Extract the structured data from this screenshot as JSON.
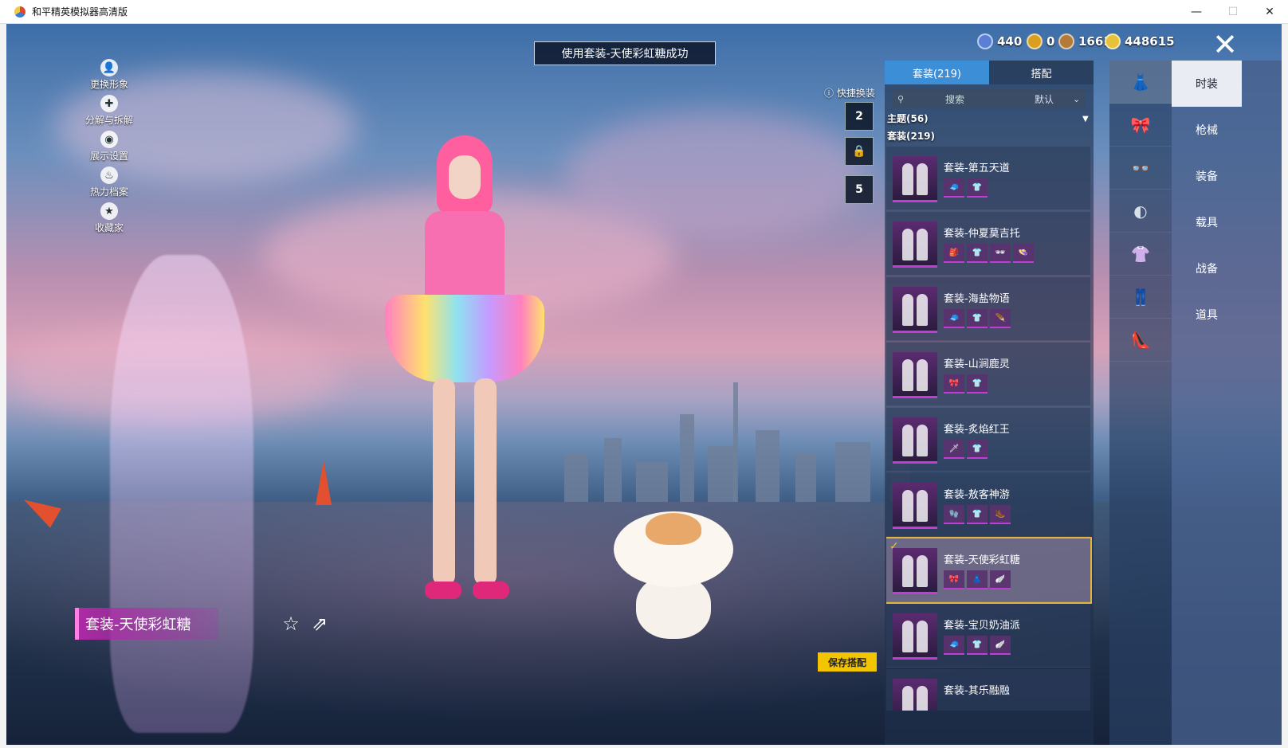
{
  "window": {
    "title": "和平精英模拟器高清版",
    "minimize": "—",
    "maximize": "☐",
    "close": "✕"
  },
  "left_menu": [
    {
      "label": "更换形象",
      "icon": "person-icon",
      "glyph": "👤"
    },
    {
      "label": "分解与拆解",
      "icon": "puzzle-icon",
      "glyph": "✚"
    },
    {
      "label": "展示设置",
      "icon": "eye-icon",
      "glyph": "◉"
    },
    {
      "label": "热力档案",
      "icon": "flame-icon",
      "glyph": "♨"
    },
    {
      "label": "收藏家",
      "icon": "collector-badge-icon",
      "glyph": "★"
    }
  ],
  "toast": "使用套装-天使彩虹糖成功",
  "currencies": [
    {
      "value": "440",
      "color": "#5a7fd6"
    },
    {
      "value": "0",
      "color": "#d9a020"
    },
    {
      "value": "1661",
      "color": "#b47a3a"
    },
    {
      "value": "448615",
      "color": "#e6c23a"
    }
  ],
  "quick_change": {
    "label": "快捷换装",
    "slots": [
      "2",
      "",
      "5"
    ]
  },
  "character_name": "套装-天使彩虹糖",
  "save_button": "保存搭配",
  "panel": {
    "tabs": [
      "套装(219)",
      "搭配"
    ],
    "search_placeholder": "搜索",
    "sort": "默认",
    "filters": [
      "主题(56)",
      "套装(219)"
    ]
  },
  "outfits": [
    {
      "name": "套装-第五天道",
      "parts": [
        "🧢",
        "👕"
      ],
      "selected": false
    },
    {
      "name": "套装-仲夏莫吉托",
      "parts": [
        "🎒",
        "👕",
        "🕶",
        "👒"
      ],
      "selected": false
    },
    {
      "name": "套装-海盐物语",
      "parts": [
        "🧢",
        "👕",
        "🪶"
      ],
      "selected": false
    },
    {
      "name": "套装-山涧鹿灵",
      "parts": [
        "🎀",
        "👕"
      ],
      "selected": false
    },
    {
      "name": "套装-炙焰红王",
      "parts": [
        "🗡",
        "👕"
      ],
      "selected": false
    },
    {
      "name": "套装-敖客神游",
      "parts": [
        "🧤",
        "👕",
        "🥾"
      ],
      "selected": false
    },
    {
      "name": "套装-天使彩虹糖",
      "parts": [
        "🎀",
        "👗",
        "🪽"
      ],
      "selected": true
    },
    {
      "name": "套装-宝贝奶油派",
      "parts": [
        "🧢",
        "👕",
        "🪽"
      ],
      "selected": false
    },
    {
      "name": "套装-其乐融融",
      "parts": [],
      "selected": false
    }
  ],
  "slot_icons": [
    "outfit-icon",
    "hat-icon",
    "glasses-icon",
    "mask-icon",
    "top-icon",
    "pants-icon",
    "shoes-icon"
  ],
  "categories": [
    "时装",
    "枪械",
    "装备",
    "载具",
    "战备",
    "道具"
  ],
  "colors": {
    "accent_tab": "#3c8fd6",
    "save_button": "#f2c500",
    "selected_outline": "#e3b33a",
    "name_tag": "#b428aa"
  }
}
